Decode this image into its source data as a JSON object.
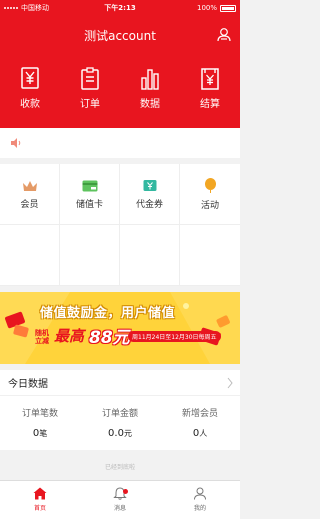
{
  "status": {
    "carrier": "中国移动",
    "time": "下午2:13",
    "battery": "100%"
  },
  "header": {
    "title": "测试account"
  },
  "quick_actions": [
    {
      "label": "收款",
      "icon": "yen-wallet-icon"
    },
    {
      "label": "订单",
      "icon": "clipboard-icon"
    },
    {
      "label": "数据",
      "icon": "bar-chart-icon"
    },
    {
      "label": "结算",
      "icon": "yen-document-icon"
    }
  ],
  "notice": {
    "icon": "speaker-icon"
  },
  "features": [
    {
      "label": "会员",
      "icon": "crown-icon"
    },
    {
      "label": "储值卡",
      "icon": "card-icon"
    },
    {
      "label": "代金券",
      "icon": "coupon-icon"
    },
    {
      "label": "活动",
      "icon": "balloon-icon"
    }
  ],
  "banner": {
    "headline": "储值鼓励金，用户储值",
    "promo_a": "随机立减",
    "promo_b": "最高",
    "promo_c": "88元",
    "date": "周11月24日至12月30日每周五"
  },
  "today": {
    "title": "今日数据",
    "stats": [
      {
        "label": "订单笔数",
        "value": "0",
        "unit": "笔"
      },
      {
        "label": "订单金额",
        "value": "0.0",
        "unit": "元"
      },
      {
        "label": "新增会员",
        "value": "0",
        "unit": "人"
      }
    ]
  },
  "loaded_text": "已经到底啦",
  "tabs": [
    {
      "label": "首页",
      "icon": "home-icon",
      "active": true
    },
    {
      "label": "消息",
      "icon": "bell-icon",
      "active": false
    },
    {
      "label": "我的",
      "icon": "person-icon",
      "active": false
    }
  ],
  "colors": {
    "brand": "#e8151f",
    "banner": "#ffd33a"
  }
}
